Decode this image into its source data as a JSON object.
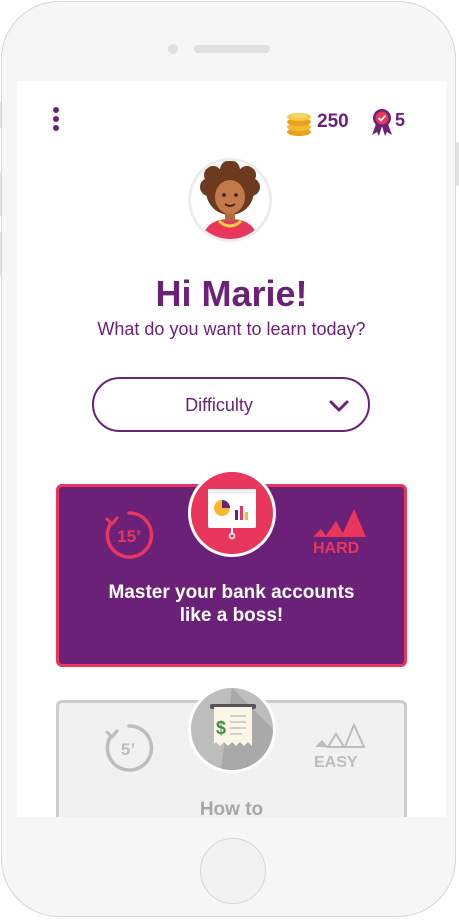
{
  "header": {
    "coins_count": "250",
    "badges_count": "5"
  },
  "greeting": "Hi Marie!",
  "subtitle": "What do you want to learn today?",
  "difficulty_dropdown": {
    "label": "Difficulty"
  },
  "cards": [
    {
      "title_line1": "Master your bank accounts",
      "title_line2": "like a boss!",
      "duration": "15’",
      "level": "HARD",
      "icon": "presentation-chart-icon"
    },
    {
      "title_line1": "How to",
      "duration": "5’",
      "level": "EASY",
      "icon": "receipt-dollar-icon"
    }
  ],
  "colors": {
    "brand_purple": "#6c2178",
    "accent_red": "#e8365d",
    "gold": "#f5b82e",
    "disabled_gray": "#bdbdbd"
  }
}
